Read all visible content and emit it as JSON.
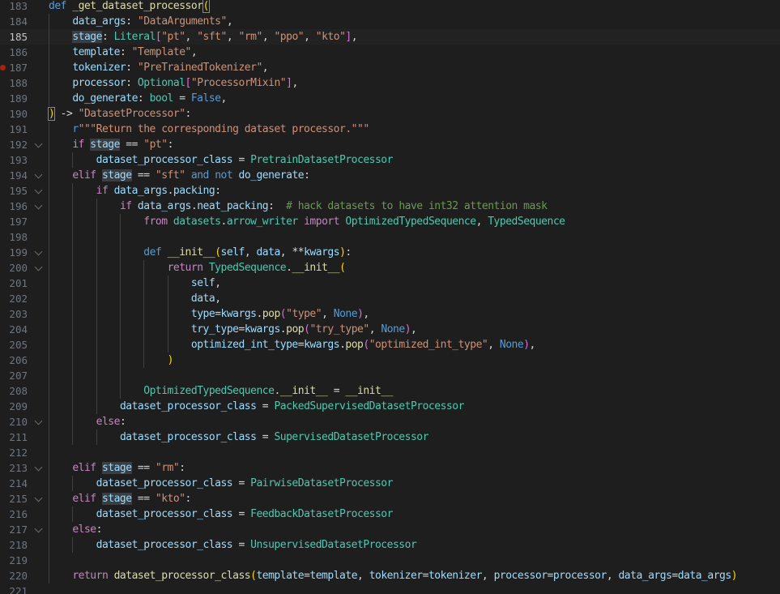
{
  "editor": {
    "language": "python",
    "first_line_number": 183,
    "active_line_number": 185,
    "breakpoint_line_number": 187,
    "highlighted_symbol": "stage",
    "lines": [
      {
        "num": "183",
        "indent": 0,
        "fold": false,
        "tokens": [
          [
            "kw",
            "def"
          ],
          [
            "op",
            " "
          ],
          [
            "fn",
            "_get_dataset_processor"
          ],
          [
            "br1bm",
            "("
          ]
        ]
      },
      {
        "num": "184",
        "indent": 1,
        "fold": false,
        "tokens": [
          [
            "var",
            "data_args"
          ],
          [
            "op",
            ": "
          ],
          [
            "str",
            "\"DataArguments\""
          ],
          [
            "op",
            ","
          ]
        ]
      },
      {
        "num": "185",
        "indent": 1,
        "fold": false,
        "tokens": [
          [
            "varhl",
            "stage"
          ],
          [
            "op",
            ": "
          ],
          [
            "cls",
            "Literal"
          ],
          [
            "br2",
            "["
          ],
          [
            "str",
            "\"pt\""
          ],
          [
            "op",
            ", "
          ],
          [
            "str",
            "\"sft\""
          ],
          [
            "op",
            ", "
          ],
          [
            "str",
            "\"rm\""
          ],
          [
            "op",
            ", "
          ],
          [
            "str",
            "\"ppo\""
          ],
          [
            "op",
            ", "
          ],
          [
            "str",
            "\"kto\""
          ],
          [
            "br2",
            "]"
          ],
          [
            "op",
            ","
          ]
        ]
      },
      {
        "num": "186",
        "indent": 1,
        "fold": false,
        "tokens": [
          [
            "var",
            "template"
          ],
          [
            "op",
            ": "
          ],
          [
            "str",
            "\"Template\""
          ],
          [
            "op",
            ","
          ]
        ]
      },
      {
        "num": "187",
        "indent": 1,
        "fold": false,
        "tokens": [
          [
            "var",
            "tokenizer"
          ],
          [
            "op",
            ": "
          ],
          [
            "str",
            "\"PreTrainedTokenizer\""
          ],
          [
            "op",
            ","
          ]
        ]
      },
      {
        "num": "188",
        "indent": 1,
        "fold": false,
        "tokens": [
          [
            "var",
            "processor"
          ],
          [
            "op",
            ": "
          ],
          [
            "cls",
            "Optional"
          ],
          [
            "br2",
            "["
          ],
          [
            "str",
            "\"ProcessorMixin\""
          ],
          [
            "br2",
            "]"
          ],
          [
            "op",
            ","
          ]
        ]
      },
      {
        "num": "189",
        "indent": 1,
        "fold": false,
        "tokens": [
          [
            "var",
            "do_generate"
          ],
          [
            "op",
            ": "
          ],
          [
            "cls",
            "bool"
          ],
          [
            "op",
            " = "
          ],
          [
            "kw",
            "False"
          ],
          [
            "op",
            ","
          ]
        ]
      },
      {
        "num": "190",
        "indent": 0,
        "fold": false,
        "tokens": [
          [
            "br1bm",
            ")"
          ],
          [
            "op",
            " -> "
          ],
          [
            "str",
            "\"DatasetProcessor\""
          ],
          [
            "op",
            ":"
          ]
        ]
      },
      {
        "num": "191",
        "indent": 1,
        "fold": false,
        "tokens": [
          [
            "kw",
            "r"
          ],
          [
            "str",
            "\"\"\"Return the corresponding dataset processor.\"\"\""
          ]
        ]
      },
      {
        "num": "192",
        "indent": 1,
        "fold": true,
        "tokens": [
          [
            "ctl",
            "if"
          ],
          [
            "op",
            " "
          ],
          [
            "varhl",
            "stage"
          ],
          [
            "op",
            " == "
          ],
          [
            "str",
            "\"pt\""
          ],
          [
            "op",
            ":"
          ]
        ]
      },
      {
        "num": "193",
        "indent": 2,
        "fold": false,
        "tokens": [
          [
            "var",
            "dataset_processor_class"
          ],
          [
            "op",
            " = "
          ],
          [
            "cls",
            "PretrainDatasetProcessor"
          ]
        ]
      },
      {
        "num": "194",
        "indent": 1,
        "fold": true,
        "tokens": [
          [
            "ctl",
            "elif"
          ],
          [
            "op",
            " "
          ],
          [
            "varhl",
            "stage"
          ],
          [
            "op",
            " == "
          ],
          [
            "str",
            "\"sft\""
          ],
          [
            "op",
            " "
          ],
          [
            "kw",
            "and"
          ],
          [
            "op",
            " "
          ],
          [
            "kw",
            "not"
          ],
          [
            "op",
            " "
          ],
          [
            "var",
            "do_generate"
          ],
          [
            "op",
            ":"
          ]
        ]
      },
      {
        "num": "195",
        "indent": 2,
        "fold": true,
        "tokens": [
          [
            "ctl",
            "if"
          ],
          [
            "op",
            " "
          ],
          [
            "var",
            "data_args"
          ],
          [
            "op",
            "."
          ],
          [
            "var",
            "packing"
          ],
          [
            "op",
            ":"
          ]
        ]
      },
      {
        "num": "196",
        "indent": 3,
        "fold": true,
        "tokens": [
          [
            "ctl",
            "if"
          ],
          [
            "op",
            " "
          ],
          [
            "var",
            "data_args"
          ],
          [
            "op",
            "."
          ],
          [
            "var",
            "neat_packing"
          ],
          [
            "op",
            ":  "
          ],
          [
            "cm",
            "# hack datasets to have int32 attention mask"
          ]
        ]
      },
      {
        "num": "197",
        "indent": 4,
        "fold": false,
        "tokens": [
          [
            "ctl",
            "from"
          ],
          [
            "op",
            " "
          ],
          [
            "cls",
            "datasets"
          ],
          [
            "op",
            "."
          ],
          [
            "cls",
            "arrow_writer"
          ],
          [
            "op",
            " "
          ],
          [
            "ctl",
            "import"
          ],
          [
            "op",
            " "
          ],
          [
            "cls",
            "OptimizedTypedSequence"
          ],
          [
            "op",
            ", "
          ],
          [
            "cls",
            "TypedSequence"
          ]
        ]
      },
      {
        "num": "198",
        "indent": 4,
        "fold": false,
        "tokens": []
      },
      {
        "num": "199",
        "indent": 4,
        "fold": true,
        "tokens": [
          [
            "kw",
            "def"
          ],
          [
            "op",
            " "
          ],
          [
            "fn",
            "__init__"
          ],
          [
            "br1",
            "("
          ],
          [
            "var",
            "self"
          ],
          [
            "op",
            ", "
          ],
          [
            "var",
            "data"
          ],
          [
            "op",
            ", **"
          ],
          [
            "var",
            "kwargs"
          ],
          [
            "br1",
            ")"
          ],
          [
            "op",
            ":"
          ]
        ]
      },
      {
        "num": "200",
        "indent": 5,
        "fold": true,
        "tokens": [
          [
            "ctl",
            "return"
          ],
          [
            "op",
            " "
          ],
          [
            "cls",
            "TypedSequence"
          ],
          [
            "op",
            "."
          ],
          [
            "fn",
            "__init__"
          ],
          [
            "br1",
            "("
          ]
        ]
      },
      {
        "num": "201",
        "indent": 6,
        "fold": false,
        "tokens": [
          [
            "var",
            "self"
          ],
          [
            "op",
            ","
          ]
        ]
      },
      {
        "num": "202",
        "indent": 6,
        "fold": false,
        "tokens": [
          [
            "var",
            "data"
          ],
          [
            "op",
            ","
          ]
        ]
      },
      {
        "num": "203",
        "indent": 6,
        "fold": false,
        "tokens": [
          [
            "var",
            "type"
          ],
          [
            "op",
            "="
          ],
          [
            "var",
            "kwargs"
          ],
          [
            "op",
            "."
          ],
          [
            "fn",
            "pop"
          ],
          [
            "br2",
            "("
          ],
          [
            "str",
            "\"type\""
          ],
          [
            "op",
            ", "
          ],
          [
            "kw",
            "None"
          ],
          [
            "br2",
            ")"
          ],
          [
            "op",
            ","
          ]
        ]
      },
      {
        "num": "204",
        "indent": 6,
        "fold": false,
        "tokens": [
          [
            "var",
            "try_type"
          ],
          [
            "op",
            "="
          ],
          [
            "var",
            "kwargs"
          ],
          [
            "op",
            "."
          ],
          [
            "fn",
            "pop"
          ],
          [
            "br2",
            "("
          ],
          [
            "str",
            "\"try_type\""
          ],
          [
            "op",
            ", "
          ],
          [
            "kw",
            "None"
          ],
          [
            "br2",
            ")"
          ],
          [
            "op",
            ","
          ]
        ]
      },
      {
        "num": "205",
        "indent": 6,
        "fold": false,
        "tokens": [
          [
            "var",
            "optimized_int_type"
          ],
          [
            "op",
            "="
          ],
          [
            "var",
            "kwargs"
          ],
          [
            "op",
            "."
          ],
          [
            "fn",
            "pop"
          ],
          [
            "br2",
            "("
          ],
          [
            "str",
            "\"optimized_int_type\""
          ],
          [
            "op",
            ", "
          ],
          [
            "kw",
            "None"
          ],
          [
            "br2",
            ")"
          ],
          [
            "op",
            ","
          ]
        ]
      },
      {
        "num": "206",
        "indent": 5,
        "fold": false,
        "tokens": [
          [
            "br1",
            ")"
          ]
        ]
      },
      {
        "num": "207",
        "indent": 4,
        "fold": false,
        "tokens": []
      },
      {
        "num": "208",
        "indent": 4,
        "fold": false,
        "tokens": [
          [
            "cls",
            "OptimizedTypedSequence"
          ],
          [
            "op",
            "."
          ],
          [
            "fn",
            "__init__"
          ],
          [
            "op",
            " = "
          ],
          [
            "fn",
            "__init__"
          ]
        ]
      },
      {
        "num": "209",
        "indent": 3,
        "fold": false,
        "tokens": [
          [
            "var",
            "dataset_processor_class"
          ],
          [
            "op",
            " = "
          ],
          [
            "cls",
            "PackedSupervisedDatasetProcessor"
          ]
        ]
      },
      {
        "num": "210",
        "indent": 2,
        "fold": true,
        "tokens": [
          [
            "ctl",
            "else"
          ],
          [
            "op",
            ":"
          ]
        ]
      },
      {
        "num": "211",
        "indent": 3,
        "fold": false,
        "tokens": [
          [
            "var",
            "dataset_processor_class"
          ],
          [
            "op",
            " = "
          ],
          [
            "cls",
            "SupervisedDatasetProcessor"
          ]
        ]
      },
      {
        "num": "212",
        "indent": 1,
        "fold": false,
        "tokens": []
      },
      {
        "num": "213",
        "indent": 1,
        "fold": true,
        "tokens": [
          [
            "ctl",
            "elif"
          ],
          [
            "op",
            " "
          ],
          [
            "varhl",
            "stage"
          ],
          [
            "op",
            " == "
          ],
          [
            "str",
            "\"rm\""
          ],
          [
            "op",
            ":"
          ]
        ]
      },
      {
        "num": "214",
        "indent": 2,
        "fold": false,
        "tokens": [
          [
            "var",
            "dataset_processor_class"
          ],
          [
            "op",
            " = "
          ],
          [
            "cls",
            "PairwiseDatasetProcessor"
          ]
        ]
      },
      {
        "num": "215",
        "indent": 1,
        "fold": true,
        "tokens": [
          [
            "ctl",
            "elif"
          ],
          [
            "op",
            " "
          ],
          [
            "varhl",
            "stage"
          ],
          [
            "op",
            " == "
          ],
          [
            "str",
            "\"kto\""
          ],
          [
            "op",
            ":"
          ]
        ]
      },
      {
        "num": "216",
        "indent": 2,
        "fold": false,
        "tokens": [
          [
            "var",
            "dataset_processor_class"
          ],
          [
            "op",
            " = "
          ],
          [
            "cls",
            "FeedbackDatasetProcessor"
          ]
        ]
      },
      {
        "num": "217",
        "indent": 1,
        "fold": true,
        "tokens": [
          [
            "ctl",
            "else"
          ],
          [
            "op",
            ":"
          ]
        ]
      },
      {
        "num": "218",
        "indent": 2,
        "fold": false,
        "tokens": [
          [
            "var",
            "dataset_processor_class"
          ],
          [
            "op",
            " = "
          ],
          [
            "cls",
            "UnsupervisedDatasetProcessor"
          ]
        ]
      },
      {
        "num": "219",
        "indent": 1,
        "fold": false,
        "tokens": []
      },
      {
        "num": "220",
        "indent": 1,
        "fold": false,
        "tokens": [
          [
            "ctl",
            "return"
          ],
          [
            "op",
            " "
          ],
          [
            "fn",
            "dataset_processor_class"
          ],
          [
            "br1",
            "("
          ],
          [
            "var",
            "template"
          ],
          [
            "op",
            "="
          ],
          [
            "var",
            "template"
          ],
          [
            "op",
            ", "
          ],
          [
            "var",
            "tokenizer"
          ],
          [
            "op",
            "="
          ],
          [
            "var",
            "tokenizer"
          ],
          [
            "op",
            ", "
          ],
          [
            "var",
            "processor"
          ],
          [
            "op",
            "="
          ],
          [
            "var",
            "processor"
          ],
          [
            "op",
            ", "
          ],
          [
            "var",
            "data_args"
          ],
          [
            "op",
            "="
          ],
          [
            "var",
            "data_args"
          ],
          [
            "br1",
            ")"
          ]
        ]
      },
      {
        "num": "221",
        "indent": 0,
        "fold": false,
        "tokens": []
      }
    ]
  }
}
